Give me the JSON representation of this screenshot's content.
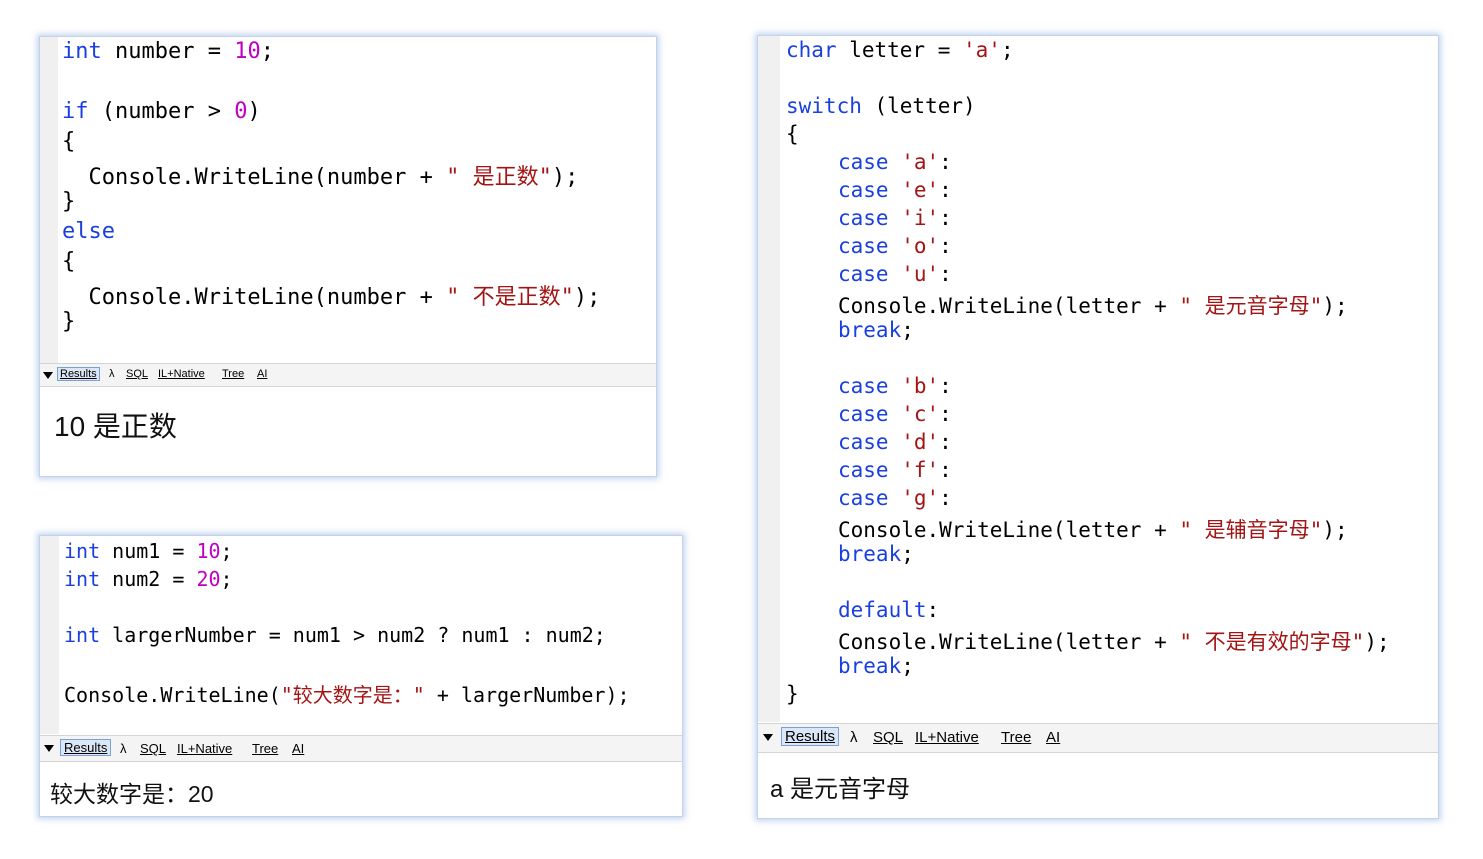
{
  "panels": {
    "if_else": {
      "code": {
        "l1": {
          "kw": "int",
          "a": " number = ",
          "num": "10",
          "b": ";"
        },
        "l2": {
          "kw": "if",
          "a": " (number > ",
          "num": "0",
          "b": ")"
        },
        "l3": "{",
        "l4": {
          "a": "  Console.WriteLine(number + ",
          "str": "\" 是正数\"",
          "b": ");"
        },
        "l5": "}",
        "l6": {
          "kw": "else"
        },
        "l7": "{",
        "l8": {
          "a": "  Console.WriteLine(number + ",
          "str": "\" 不是正数\"",
          "b": ");"
        },
        "l9": "}"
      },
      "result": "10 是正数"
    },
    "ternary": {
      "code": {
        "l1": {
          "kw": "int",
          "a": " num1 = ",
          "num": "10",
          "b": ";"
        },
        "l2": {
          "kw": "int",
          "a": " num2 = ",
          "num": "20",
          "b": ";"
        },
        "l3": {
          "kw": "int",
          "a": " largerNumber = num1 > num2 ? num1 : num2;"
        },
        "l4": {
          "a": "Console.WriteLine(",
          "str": "\"较大数字是：\"",
          "b": " + largerNumber);"
        }
      },
      "result": "较大数字是：20"
    },
    "switch": {
      "code": {
        "l1": {
          "kw": "char",
          "a": " letter = ",
          "str": "'a'",
          "b": ";"
        },
        "l2": {
          "kw": "switch",
          "a": " (letter)"
        },
        "l3": "{",
        "vowels": [
          "'a'",
          "'e'",
          "'i'",
          "'o'",
          "'u'"
        ],
        "vowel_write": {
          "a": "Console.WriteLine(letter + ",
          "str": "\" 是元音字母\"",
          "b": ");"
        },
        "consonants": [
          "'b'",
          "'c'",
          "'d'",
          "'f'",
          "'g'"
        ],
        "consonant_write": {
          "a": "Console.WriteLine(letter + ",
          "str": "\" 是辅音字母\"",
          "b": ");"
        },
        "default_kw": "default",
        "default_write": {
          "a": "Console.WriteLine(letter + ",
          "str": "\" 不是有效的字母\"",
          "b": ");"
        },
        "case_kw": "case",
        "colon": ":",
        "break_kw": "break",
        "semi": ";",
        "close": "}"
      },
      "result": "a 是元音字母"
    }
  },
  "toolbar": {
    "results": "Results",
    "lambda": "λ",
    "sql": "SQL",
    "il": "IL+Native",
    "tree": "Tree",
    "ai": "AI"
  }
}
